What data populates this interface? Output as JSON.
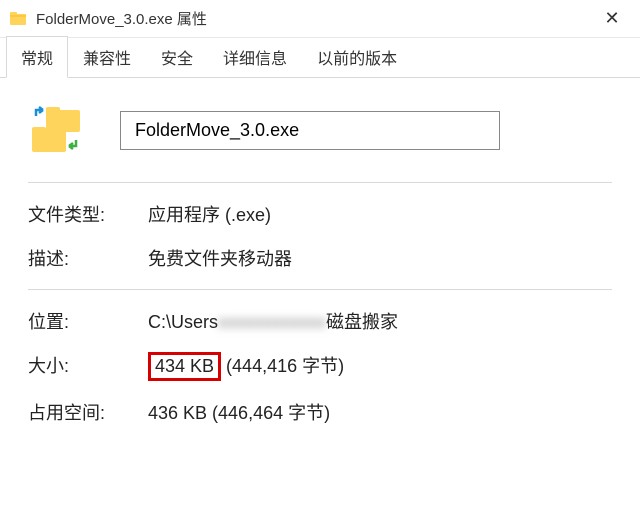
{
  "window": {
    "title": "FolderMove_3.0.exe 属性",
    "close_glyph": "✕"
  },
  "tabs": {
    "items": [
      {
        "label": "常规",
        "active": true
      },
      {
        "label": "兼容性",
        "active": false
      },
      {
        "label": "安全",
        "active": false
      },
      {
        "label": "详细信息",
        "active": false
      },
      {
        "label": "以前的版本",
        "active": false
      }
    ]
  },
  "general": {
    "filename": "FolderMove_3.0.exe",
    "file_type_label": "文件类型:",
    "file_type_value": "应用程序 (.exe)",
    "description_label": "描述:",
    "description_value": "免费文件夹移动器",
    "location_label": "位置:",
    "location_prefix": "C:\\Users",
    "location_blurred": "xxxxxxxxxxxx",
    "location_suffix": "磁盘搬家",
    "size_label": "大小:",
    "size_highlight": "434 KB",
    "size_rest": " (444,416 字节)",
    "size_on_disk_label": "占用空间:",
    "size_on_disk_value": "436 KB (446,464 字节)"
  }
}
